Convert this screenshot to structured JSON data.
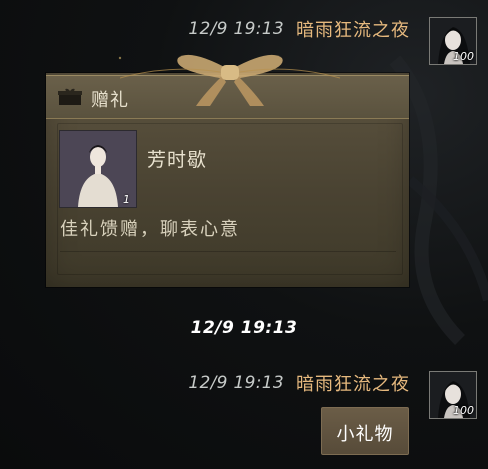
{
  "messages": [
    {
      "timestamp": "12/9 19:13",
      "sender": "暗雨狂流之夜",
      "avatar_level": "100",
      "gift": {
        "header_title": "赠礼",
        "item_name": "芳时歇",
        "item_count": "1",
        "message": "佳礼馈赠，聊表心意"
      }
    },
    {
      "timestamp": "12/9 19:13",
      "sender": "暗雨狂流之夜",
      "avatar_level": "100",
      "text": "小礼物"
    }
  ],
  "divider_time": "12/9 19:13",
  "colors": {
    "sender": "#e6b97e",
    "timestamp": "#c6cac8",
    "card": "#4f4836",
    "bubble": "#5f5240",
    "background": "#0f1112"
  },
  "icons": [
    "gift-box-icon",
    "ribbon-bow-icon"
  ]
}
